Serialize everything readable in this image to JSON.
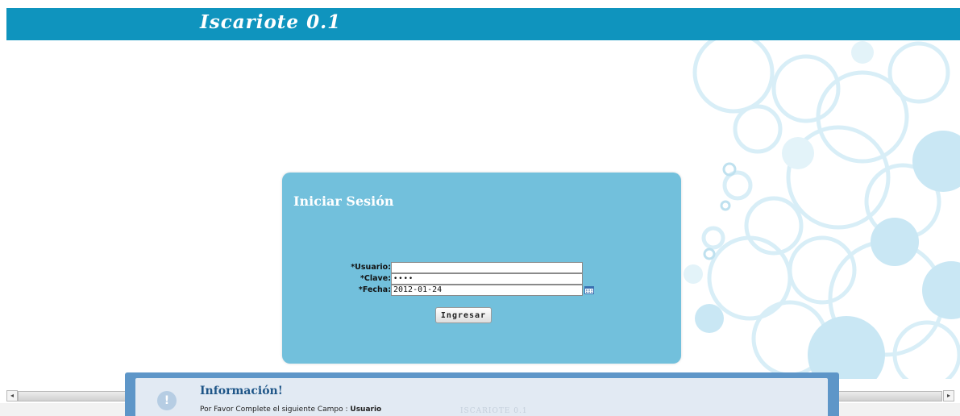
{
  "header": {
    "app_title": "Iscariote 0.1"
  },
  "login": {
    "title": "Iniciar Sesión",
    "usuario_label": "*Usuario:",
    "usuario_value": "",
    "clave_label": "*Clave:",
    "clave_value": "••••",
    "fecha_label": "*Fecha:",
    "fecha_value": "2012-01-24",
    "submit_label": "Ingresar"
  },
  "dialog": {
    "title": "Información!",
    "message": "Por Favor Complete el siguiente Campo  : ",
    "field_name": "Usuario",
    "background_text": "ISCARIOTE 0.1"
  },
  "icons": [
    "calendar-icon",
    "info-icon",
    "arrow-left-icon",
    "arrow-right-icon"
  ],
  "colors": {
    "header": "#0f94be",
    "panel": "#72c0dc",
    "dialog_frame": "#5e96c8",
    "dialog_title": "#1f5688"
  }
}
